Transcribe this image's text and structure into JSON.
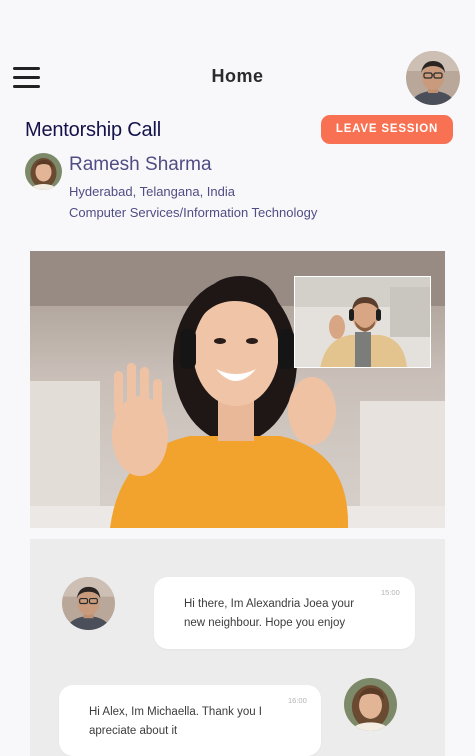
{
  "header": {
    "title": "Home",
    "menu_icon": "hamburger-menu-icon",
    "user_avatar": "user-avatar"
  },
  "session": {
    "title": "Mentorship Call",
    "leave_label": "LEAVE SESSION",
    "leave_color": "#f87152"
  },
  "mentor": {
    "name": "Ramesh Sharma",
    "location": "Hyderabad, Telangana, India",
    "industry": "Computer Services/Information Technology"
  },
  "chat": {
    "messages": [
      {
        "text_line1": "Hi there, Im Alexandria Joea your",
        "text_line2": "new neighbour. Hope you enjoy",
        "time": "15:00"
      },
      {
        "text_line1": "Hi Alex, Im Michaella. Thank you I",
        "text_line2": "apreciate about it",
        "time": "16:00"
      }
    ]
  },
  "colors": {
    "title_navy": "#14124a",
    "mentor_text": "#4f4d83",
    "chat_bg": "#ececec"
  }
}
